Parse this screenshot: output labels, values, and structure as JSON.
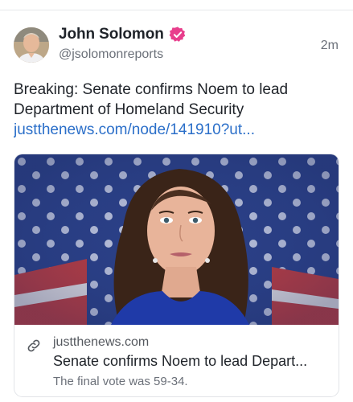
{
  "post": {
    "author_name": "John Solomon",
    "handle": "@jsolomonreports",
    "timestamp": "2m",
    "verified_badge_color": "#e83e8c",
    "text": "Breaking: Senate confirms Noem to lead Department of Homeland Security",
    "link_text": "justthenews.com/node/141910?ut..."
  },
  "card": {
    "domain": "justthenews.com",
    "title": "Senate confirms Noem to lead Depart...",
    "description": "The final vote was 59-34."
  },
  "colors": {
    "link": "#2b6fc9",
    "text": "#1f2329",
    "secondary": "#6b7079"
  },
  "icons": {
    "verified": "verified-badge-icon",
    "link": "link-icon"
  }
}
